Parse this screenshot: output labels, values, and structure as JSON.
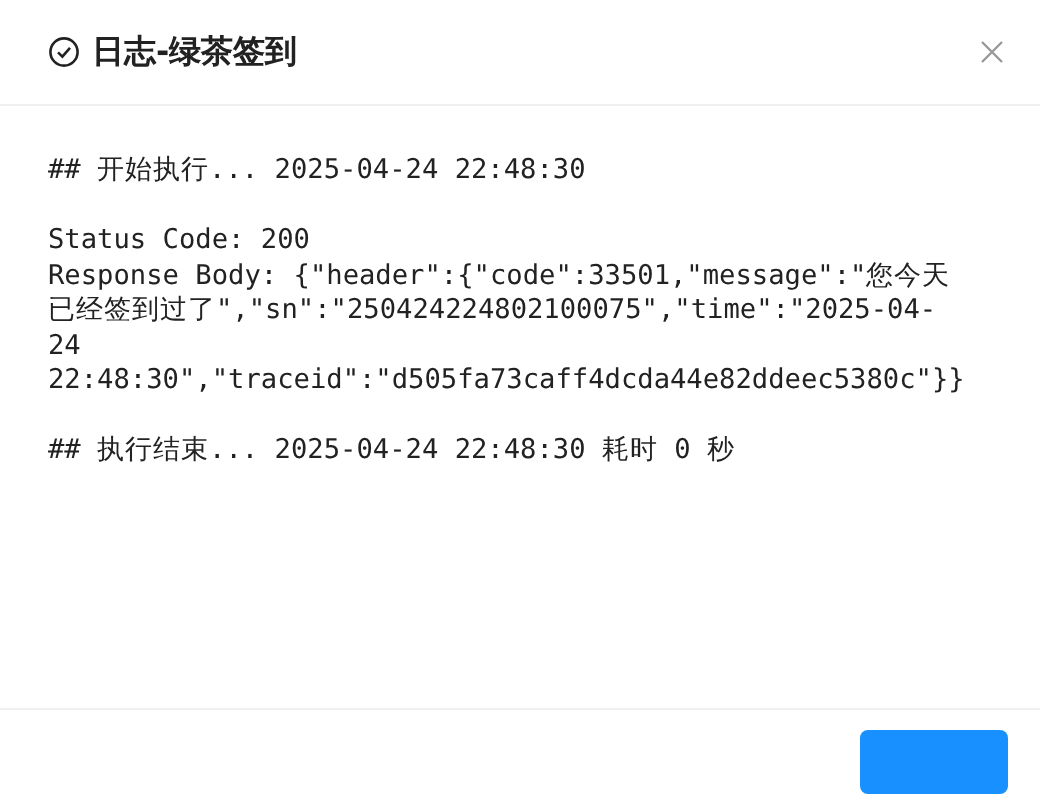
{
  "dialog": {
    "title": "日志-绿茶签到",
    "log_blocks": [
      [
        "## 开始执行... 2025-04-24 22:48:30"
      ],
      [
        "Status Code: 200",
        "Response Body: {\"header\":{\"code\":33501,\"message\":\"您今天",
        "已经签到过了\",\"sn\":\"250424224802100075\",\"time\":\"2025-04-",
        "24",
        "22:48:30\",\"traceid\":\"d505fa73caff4dcda44e82ddeec5380c\"}}"
      ],
      [
        "## 执行结束... 2025-04-24 22:48:30 耗时 0 秒"
      ]
    ],
    "footer_button": {
      "kind": "primary"
    }
  }
}
